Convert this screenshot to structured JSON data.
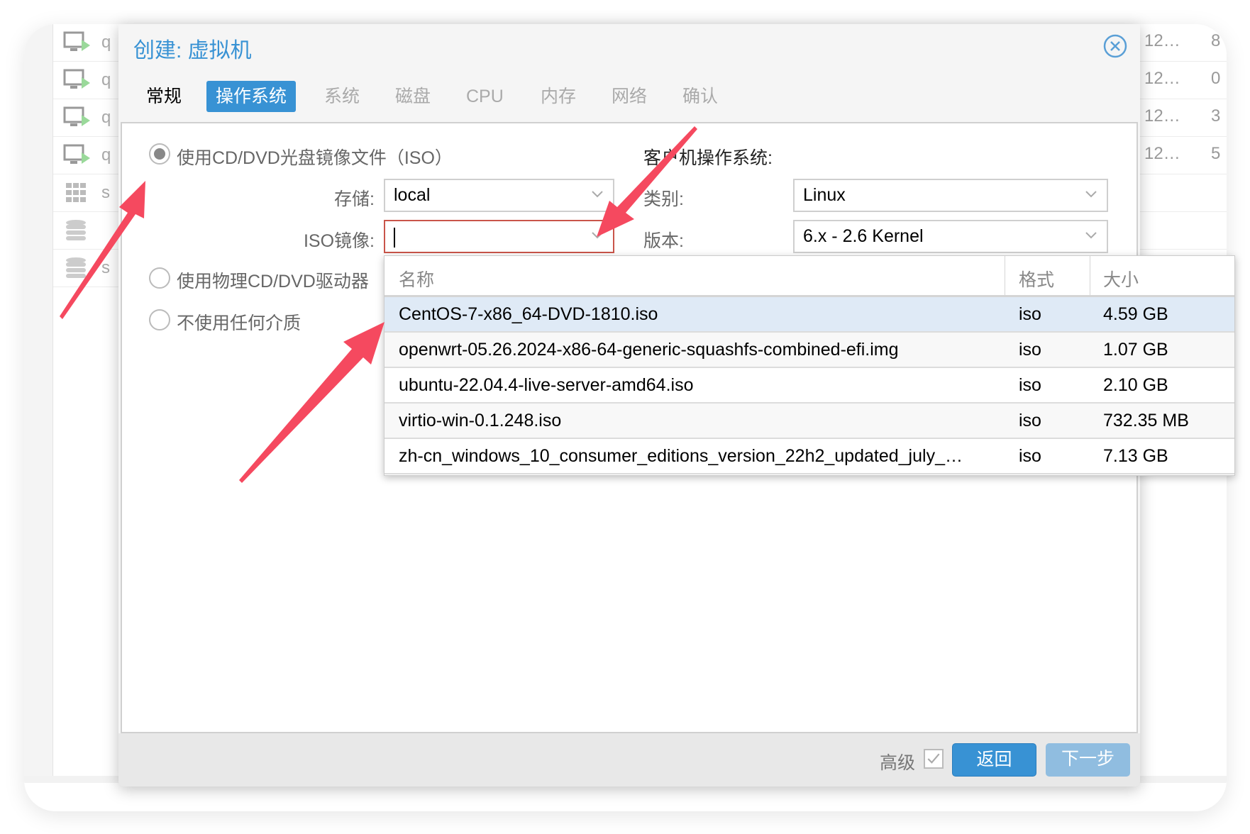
{
  "background": {
    "tree_rows": [
      {
        "icon": "vm-running-icon",
        "text": "q"
      },
      {
        "icon": "vm-running-icon",
        "text": "q"
      },
      {
        "icon": "vm-running-icon",
        "text": "q"
      },
      {
        "icon": "vm-running-icon",
        "text": "q"
      },
      {
        "icon": "grid-icon",
        "text": "s"
      },
      {
        "icon": "storage-icon",
        "text": ""
      },
      {
        "icon": "storage-icon",
        "text": "s"
      }
    ],
    "right_rows": [
      {
        "a": "12…",
        "b": "8"
      },
      {
        "a": "12…",
        "b": "0"
      },
      {
        "a": "12…",
        "b": "3"
      },
      {
        "a": "12…",
        "b": "5"
      }
    ]
  },
  "dialog": {
    "title": "创建: 虚拟机",
    "tabs": [
      "常规",
      "操作系统",
      "系统",
      "磁盘",
      "CPU",
      "内存",
      "网络",
      "确认"
    ],
    "active_tab": "操作系统",
    "media": {
      "option_iso": "使用CD/DVD光盘镜像文件（ISO）",
      "option_physical": "使用物理CD/DVD驱动器",
      "option_none": "不使用任何介质",
      "selected": "option_iso",
      "storage_label": "存储:",
      "storage_value": "local",
      "iso_label": "ISO镜像:",
      "iso_value": ""
    },
    "guest_os": {
      "heading": "客户机操作系统:",
      "type_label": "类别:",
      "type_value": "Linux",
      "version_label": "版本:",
      "version_value": "6.x - 2.6 Kernel"
    },
    "iso_list": {
      "columns": [
        "名称",
        "格式",
        "大小"
      ],
      "rows": [
        {
          "name": "CentOS-7-x86_64-DVD-1810.iso",
          "format": "iso",
          "size": "4.59 GB",
          "selected": true
        },
        {
          "name": "openwrt-05.26.2024-x86-64-generic-squashfs-combined-efi.img",
          "format": "iso",
          "size": "1.07 GB"
        },
        {
          "name": "ubuntu-22.04.4-live-server-amd64.iso",
          "format": "iso",
          "size": "2.10 GB"
        },
        {
          "name": "virtio-win-0.1.248.iso",
          "format": "iso",
          "size": "732.35 MB"
        },
        {
          "name": "zh-cn_windows_10_consumer_editions_version_22h2_updated_july_…",
          "format": "iso",
          "size": "7.13 GB"
        }
      ]
    },
    "footer": {
      "advanced_label": "高级",
      "advanced_checked": true,
      "back_label": "返回",
      "next_label": "下一步"
    }
  },
  "colors": {
    "accent": "#3892d4",
    "annotation_arrow": "#f5495f",
    "error_border": "#c9554a"
  }
}
